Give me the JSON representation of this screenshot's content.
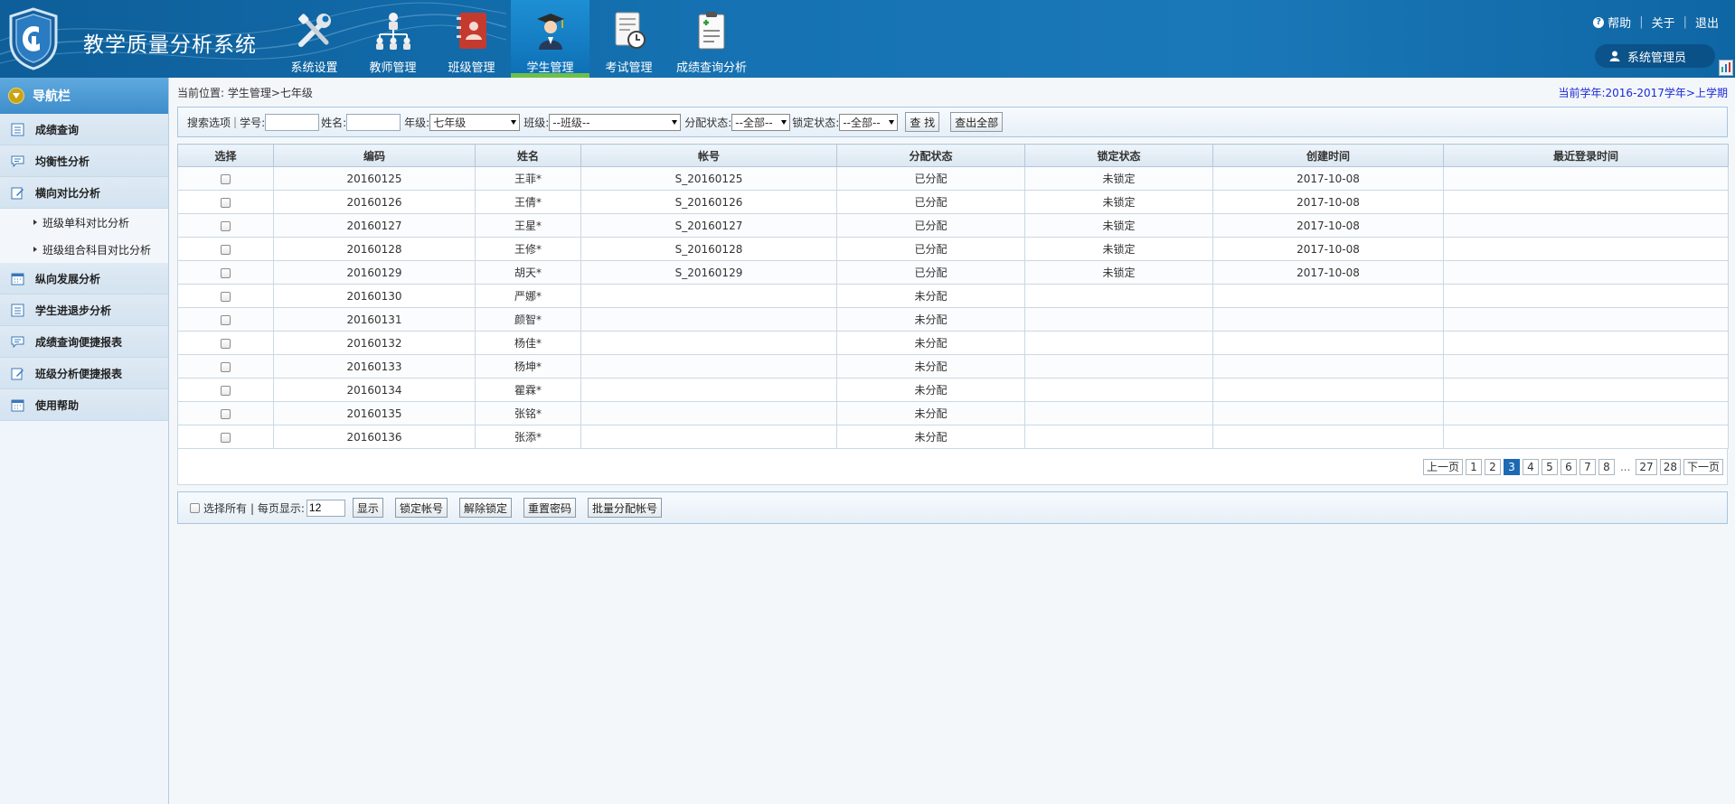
{
  "header": {
    "title": "教学质量分析系统",
    "nav": [
      {
        "label": "系统设置",
        "icon": "wrench-icon",
        "active": false
      },
      {
        "label": "教师管理",
        "icon": "org-chart-icon",
        "active": false
      },
      {
        "label": "班级管理",
        "icon": "contact-book-icon",
        "active": false
      },
      {
        "label": "学生管理",
        "icon": "student-icon",
        "active": true
      },
      {
        "label": "考试管理",
        "icon": "exam-clock-icon",
        "active": false
      },
      {
        "label": "成绩查询分析",
        "icon": "clipboard-icon",
        "active": false
      }
    ],
    "links": {
      "help": "帮助",
      "about": "关于",
      "logout": "退出"
    },
    "user": "系统管理员"
  },
  "sidebar": {
    "title": "导航栏",
    "items": [
      {
        "label": "成绩查询",
        "icon": "list-icon"
      },
      {
        "label": "均衡性分析",
        "icon": "chat-icon"
      },
      {
        "label": "横向对比分析",
        "icon": "edit-icon"
      },
      {
        "label": "纵向发展分析",
        "icon": "calendar-icon"
      },
      {
        "label": "学生进退步分析",
        "icon": "list-icon"
      },
      {
        "label": "成绩查询便捷报表",
        "icon": "chat-icon"
      },
      {
        "label": "班级分析便捷报表",
        "icon": "edit-icon"
      },
      {
        "label": "使用帮助",
        "icon": "calendar-icon"
      }
    ],
    "subitems": [
      "班级单科对比分析",
      "班级组合科目对比分析"
    ]
  },
  "main": {
    "breadcrumb": "当前位置: 学生管理>七年级",
    "term": "当前学年:2016-2017学年>上学期",
    "search": {
      "options_label": "搜索选项",
      "student_no_label": "学号:",
      "name_label": "姓名:",
      "grade_label": "年级:",
      "grade_value": "七年级",
      "class_label": "班级:",
      "class_value": "--班级--",
      "assign_label": "分配状态:",
      "assign_value": "--全部--",
      "lock_label": "锁定状态:",
      "lock_value": "--全部--",
      "search_btn": "查 找",
      "all_btn": "查出全部"
    },
    "table": {
      "columns": [
        "选择",
        "编码",
        "姓名",
        "帐号",
        "分配状态",
        "锁定状态",
        "创建时间",
        "最近登录时间"
      ],
      "rows": [
        [
          "20160125",
          "王菲*",
          "S_20160125",
          "已分配",
          "未锁定",
          "2017-10-08",
          ""
        ],
        [
          "20160126",
          "王倩*",
          "S_20160126",
          "已分配",
          "未锁定",
          "2017-10-08",
          ""
        ],
        [
          "20160127",
          "王星*",
          "S_20160127",
          "已分配",
          "未锁定",
          "2017-10-08",
          ""
        ],
        [
          "20160128",
          "王修*",
          "S_20160128",
          "已分配",
          "未锁定",
          "2017-10-08",
          ""
        ],
        [
          "20160129",
          "胡天*",
          "S_20160129",
          "已分配",
          "未锁定",
          "2017-10-08",
          ""
        ],
        [
          "20160130",
          "严娜*",
          "",
          "未分配",
          "",
          "",
          ""
        ],
        [
          "20160131",
          "颜智*",
          "",
          "未分配",
          "",
          "",
          ""
        ],
        [
          "20160132",
          "杨佳*",
          "",
          "未分配",
          "",
          "",
          ""
        ],
        [
          "20160133",
          "杨坤*",
          "",
          "未分配",
          "",
          "",
          ""
        ],
        [
          "20160134",
          "瞿霖*",
          "",
          "未分配",
          "",
          "",
          ""
        ],
        [
          "20160135",
          "张铭*",
          "",
          "未分配",
          "",
          "",
          ""
        ],
        [
          "20160136",
          "张添*",
          "",
          "未分配",
          "",
          "",
          ""
        ]
      ]
    },
    "pager": {
      "prev": "上一页",
      "next": "下一页",
      "pages": [
        "1",
        "2",
        "3",
        "4",
        "5",
        "6",
        "7",
        "8",
        "...",
        "27",
        "28"
      ],
      "current": "3"
    },
    "actions": {
      "select_all": "选择所有",
      "per_page_label": "| 每页显示:",
      "per_page_value": "12",
      "show_btn": "显示",
      "lock_btn": "锁定帐号",
      "unlock_btn": "解除锁定",
      "reset_btn": "重置密码",
      "batch_btn": "批量分配帐号"
    }
  },
  "colors": {
    "header": "#1571b1",
    "active_nav": "#1e8fd4",
    "active_bar": "#6cc04a",
    "pager_current": "#1c6ab3",
    "term_text": "#1a2ad6"
  }
}
